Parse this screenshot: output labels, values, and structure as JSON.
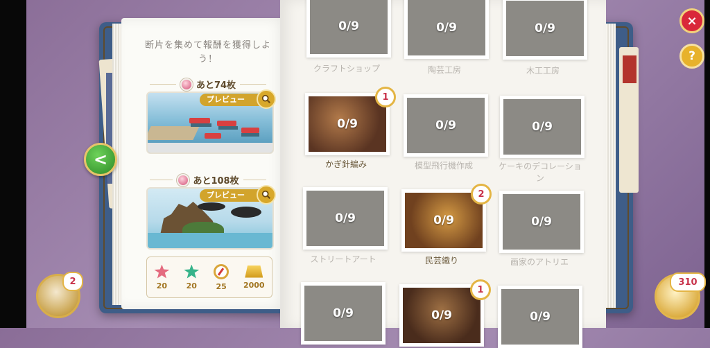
{
  "header": {
    "title": "断片を集めて報酬を獲得しよう！"
  },
  "rewards_panel": {
    "reward1": {
      "remaining": "あと74枚",
      "preview_label": "プレビュー"
    },
    "reward2": {
      "remaining": "あと108枚",
      "preview_label": "プレビュー"
    },
    "items": [
      {
        "icon": "pink-star-icon",
        "value": "20"
      },
      {
        "icon": "green-star-icon",
        "value": "20"
      },
      {
        "icon": "compass-icon",
        "value": "25"
      },
      {
        "icon": "gold-bars-icon",
        "value": "2000"
      }
    ]
  },
  "cards": [
    {
      "progress": "0/9",
      "label": "クラフトショップ",
      "badge": ""
    },
    {
      "progress": "0/9",
      "label": "陶芸工房",
      "badge": ""
    },
    {
      "progress": "0/9",
      "label": "木工工房",
      "badge": ""
    },
    {
      "progress": "0/9",
      "label": "かぎ針編み",
      "badge": "1"
    },
    {
      "progress": "0/9",
      "label": "模型飛行機作成",
      "badge": ""
    },
    {
      "progress": "0/9",
      "label": "ケーキのデコレーション",
      "badge": ""
    },
    {
      "progress": "0/9",
      "label": "ストリートアート",
      "badge": ""
    },
    {
      "progress": "0/9",
      "label": "民芸織り",
      "badge": "2"
    },
    {
      "progress": "0/9",
      "label": "画家のアトリエ",
      "badge": ""
    },
    {
      "progress": "0/9",
      "label": "",
      "badge": ""
    },
    {
      "progress": "0/9",
      "label": "",
      "badge": "1"
    },
    {
      "progress": "0/9",
      "label": "",
      "badge": ""
    }
  ],
  "controls": {
    "close": "×",
    "help": "?",
    "back": "<",
    "album_count": "2",
    "pieces_count": "310"
  },
  "colors": {
    "background": "#a58cb2",
    "gold": "#d2a42c",
    "close_red": "#d9283a"
  }
}
